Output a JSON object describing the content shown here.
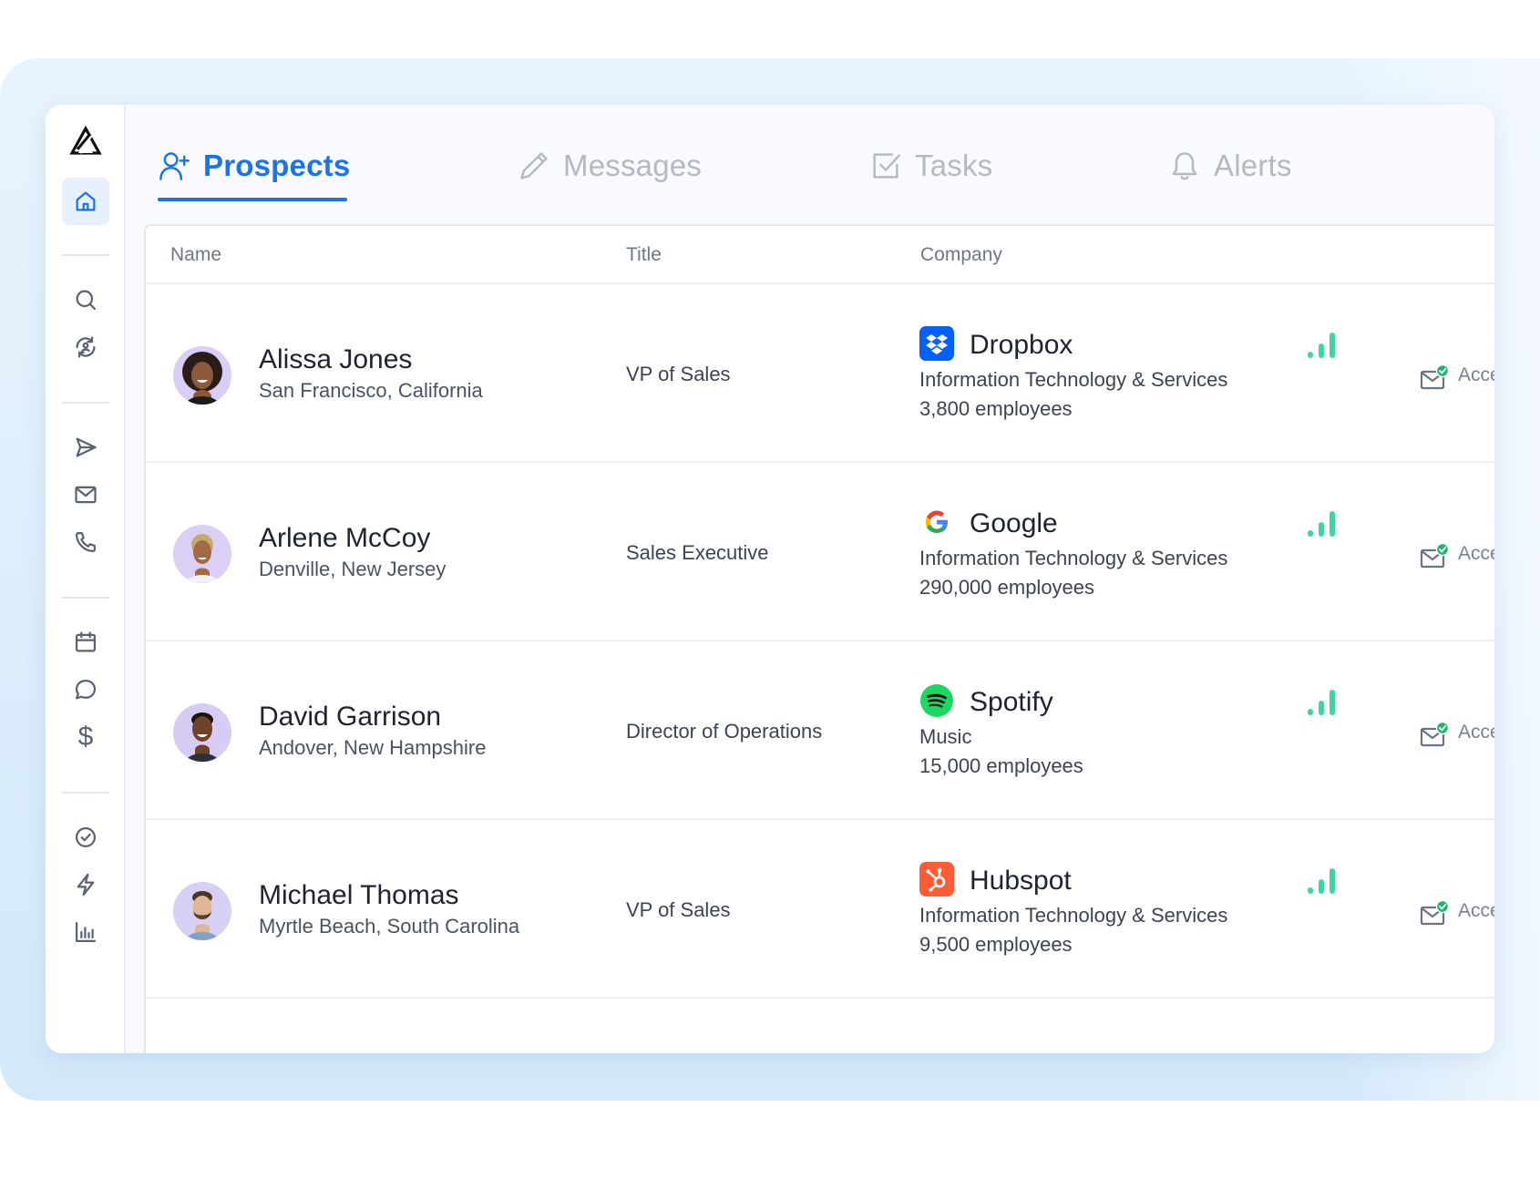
{
  "tabs": [
    {
      "label": "Prospects",
      "icon": "user-plus-icon",
      "active": true
    },
    {
      "label": "Messages",
      "icon": "pencil-icon",
      "active": false
    },
    {
      "label": "Tasks",
      "icon": "checkbox-icon",
      "active": false
    },
    {
      "label": "Alerts",
      "icon": "bell-icon",
      "active": false
    }
  ],
  "sidebar": {
    "items": [
      "home-icon",
      "search-icon",
      "refresh-user-icon",
      "send-icon",
      "mail-icon",
      "phone-icon",
      "calendar-icon",
      "chat-icon",
      "dollar-icon",
      "check-circle-icon",
      "lightning-icon",
      "bar-chart-icon"
    ],
    "dollar_glyph": "$"
  },
  "table": {
    "headers": [
      "Name",
      "Title",
      "Company"
    ],
    "rows": [
      {
        "name": "Alissa Jones",
        "location": "San Francisco, California",
        "title": "VP of Sales",
        "company": "Dropbox",
        "industry": "Information Technology & Services",
        "employees": "3,800 employees",
        "status": "Acce"
      },
      {
        "name": "Arlene McCoy",
        "location": "Denville, New Jersey",
        "title": "Sales Executive",
        "company": "Google",
        "industry": "Information Technology & Services",
        "employees": "290,000 employees",
        "status": "Acce"
      },
      {
        "name": "David Garrison",
        "location": "Andover, New Hampshire",
        "title": "Director of Operations",
        "company": "Spotify",
        "industry": "Music",
        "employees": "15,000 employees",
        "status": "Acce"
      },
      {
        "name": "Michael Thomas",
        "location": "Myrtle Beach, South Carolina",
        "title": "VP of Sales",
        "company": "Hubspot",
        "industry": "Information Technology & Services",
        "employees": "9,500 employees",
        "status": "Acce"
      }
    ]
  },
  "colors": {
    "accent": "#1a73e8",
    "signal": "#3dd6a3",
    "dropbox": "#0061fe",
    "spotify": "#1ed760",
    "hubspot": "#ff5c35",
    "check_badge": "#22b46e"
  }
}
